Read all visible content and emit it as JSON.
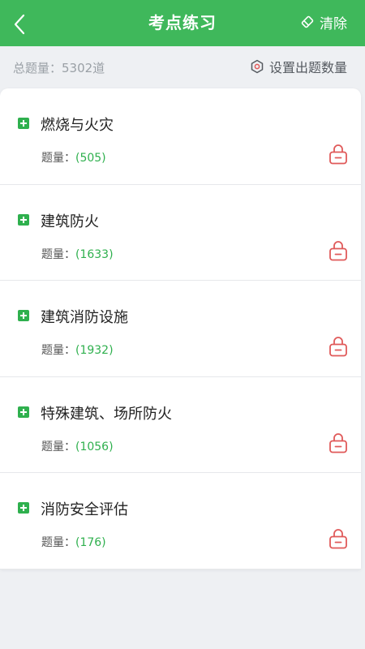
{
  "header": {
    "title": "考点练习",
    "clear_label": "清除"
  },
  "summary": {
    "total_label": "总题量：5302道",
    "set_count_label": "设置出题数量"
  },
  "items": [
    {
      "title": "燃烧与火灾",
      "count_label": "题量：",
      "count": "(505)"
    },
    {
      "title": "建筑防火",
      "count_label": "题量：",
      "count": "(1633)"
    },
    {
      "title": "建筑消防设施",
      "count_label": "题量：",
      "count": "(1932)"
    },
    {
      "title": "特殊建筑、场所防火",
      "count_label": "题量：",
      "count": "(1056)"
    },
    {
      "title": "消防安全评估",
      "count_label": "题量：",
      "count": "(176)"
    }
  ],
  "colors": {
    "header_bg": "#3fb85b",
    "accent_green": "#2fb04e",
    "lock_red": "#e05a5a"
  }
}
